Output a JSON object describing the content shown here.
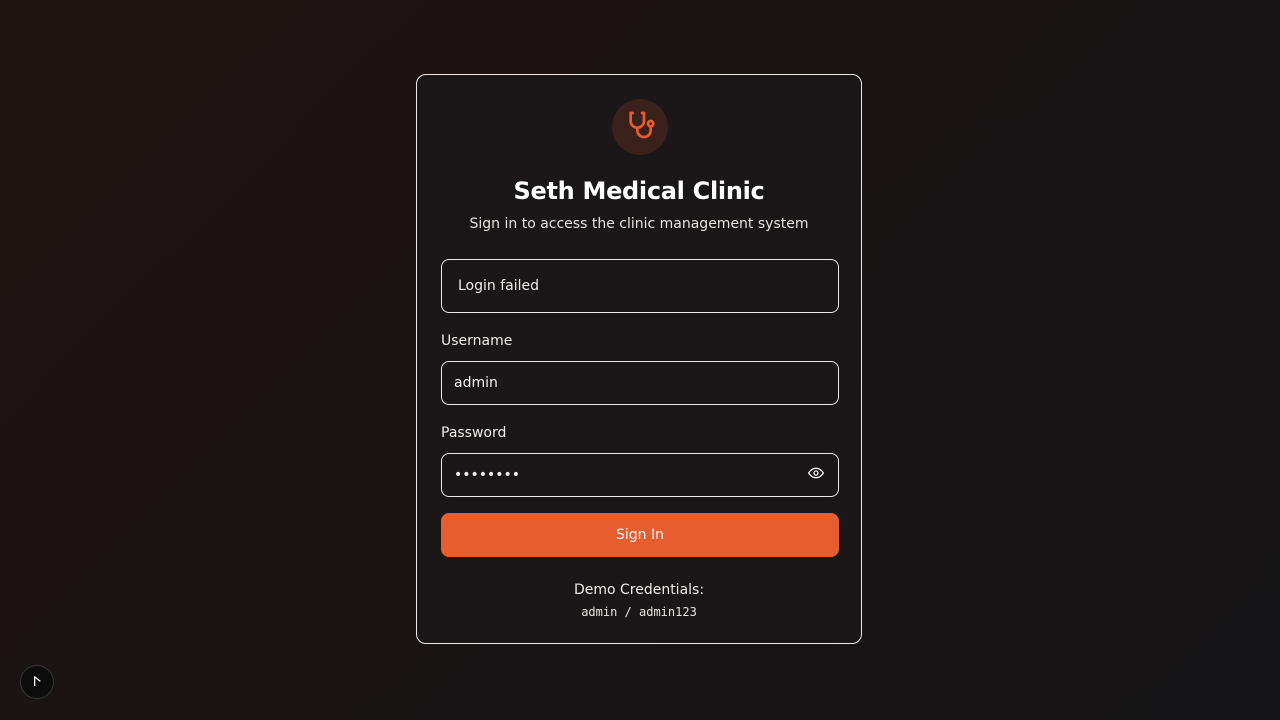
{
  "brand": {
    "icon": "stethoscope-icon",
    "title": "Seth Medical Clinic",
    "subtitle": "Sign in to access the clinic management system",
    "accent_color": "#e85d2f"
  },
  "alert": {
    "message": "Login failed"
  },
  "form": {
    "username_label": "Username",
    "username_value": "admin",
    "password_label": "Password",
    "password_value": "••••••••",
    "password_toggle_icon": "eye-icon",
    "submit_label": "Sign In"
  },
  "demo": {
    "title": "Demo Credentials:",
    "credentials": "admin / admin123"
  },
  "floating_button": {
    "icon": "cursor-icon"
  }
}
